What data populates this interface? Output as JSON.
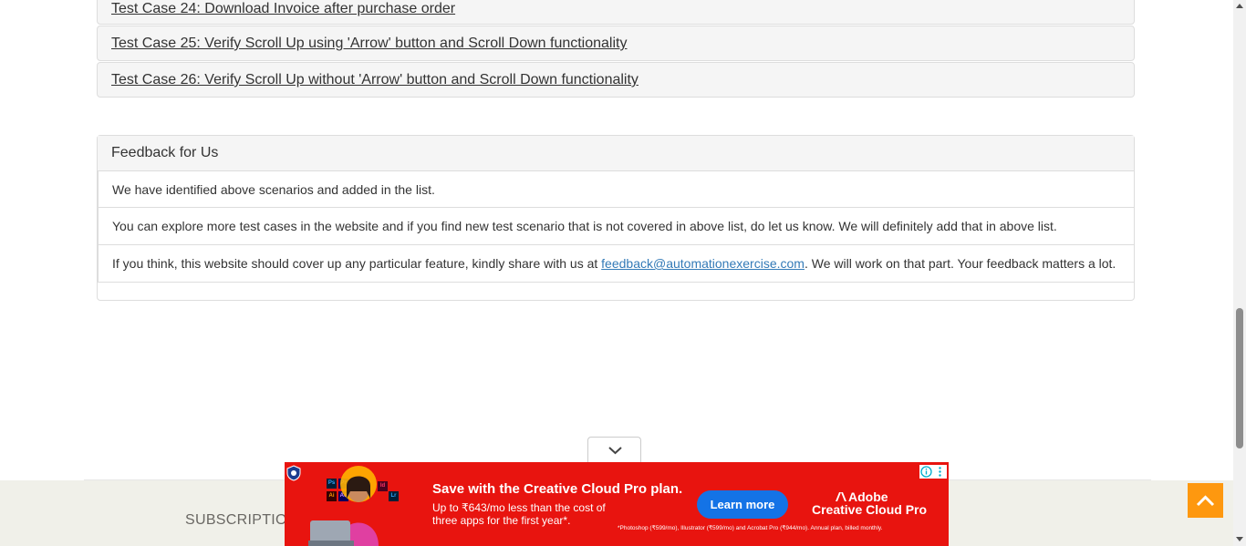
{
  "test_cases": [
    {
      "label": "Test Case 24: Download Invoice after purchase order"
    },
    {
      "label": "Test Case 25: Verify Scroll Up using 'Arrow' button and Scroll Down functionality"
    },
    {
      "label": "Test Case 26: Verify Scroll Up without 'Arrow' button and Scroll Down functionality"
    }
  ],
  "feedback": {
    "heading": "Feedback for Us",
    "line1": "We have identified above scenarios and added in the list.",
    "line2": "You can explore more test cases in the website and if you find new test scenario that is not covered in above list, do let us know. We will definitely add that in above list.",
    "line3_prefix": "If you think, this website should cover up any particular feature, kindly share with us at ",
    "email": "feedback@automationexercise.com",
    "line3_suffix": ". We will work on that part. Your feedback matters a lot."
  },
  "footer": {
    "subscription": "SUBSCRIPTIO"
  },
  "ad": {
    "title": "Save with the Creative Cloud Pro plan.",
    "subtitle": "Up to ₹643/mo less than the cost of three apps for the first year*.",
    "button": "Learn more",
    "brand_line1": "Adobe",
    "brand_line2": "Creative Cloud Pro",
    "fine_print": "*Photoshop (₹599/mo), Illustrator (₹599/mo) and Acrobat Pro (₹944/mo). Annual plan, billed monthly.",
    "app_tiles": [
      "Ps",
      "Pr",
      "Id",
      "Ai",
      "Ae",
      "Lr"
    ]
  },
  "colors": {
    "accent": "#fe980f",
    "ad_red": "#e8140f",
    "ad_button": "#1473e6",
    "link": "#337ab7",
    "footer_bg": "#f0f0e9"
  },
  "icons": {
    "scroll_up": "chevron-up-icon",
    "ad_toggle": "chevron-down-icon",
    "ad_info": "info-icon",
    "ad_menu": "kebab-menu-icon"
  }
}
